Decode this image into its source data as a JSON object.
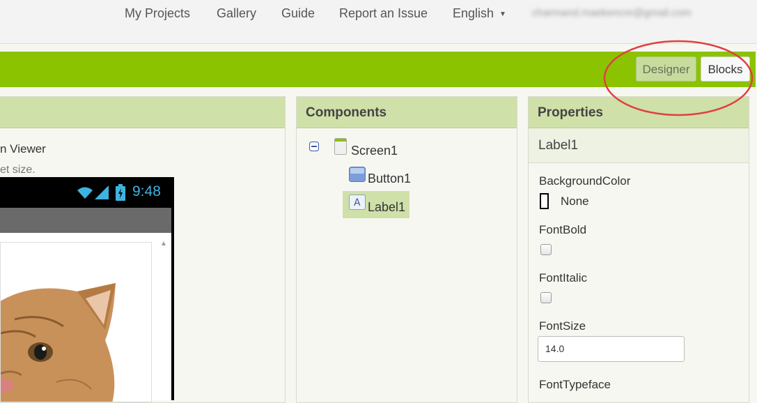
{
  "topnav": {
    "items": [
      "My Projects",
      "Gallery",
      "Guide",
      "Report an Issue"
    ],
    "language": "English",
    "account_email": "charmand.maekencre@gmail.com"
  },
  "toolbar": {
    "designer_label": "Designer",
    "blocks_label": "Blocks"
  },
  "viewer": {
    "line1": "n Viewer",
    "line2": "et size.",
    "phone_time": "9:48"
  },
  "components": {
    "title": "Components",
    "tree": [
      "Screen1",
      "Button1",
      "Label1"
    ],
    "selected": "Label1"
  },
  "properties": {
    "title": "Properties",
    "component_name": "Label1",
    "background_color_label": "BackgroundColor",
    "background_color_value": "None",
    "font_bold_label": "FontBold",
    "font_bold_checked": false,
    "font_italic_label": "FontItalic",
    "font_italic_checked": false,
    "font_size_label": "FontSize",
    "font_size_value": "14.0",
    "font_typeface_label": "FontTypeface"
  },
  "colors": {
    "accent_green": "#8bc300",
    "panel_header": "#cfe0a9",
    "annotation_red": "#e04040"
  }
}
